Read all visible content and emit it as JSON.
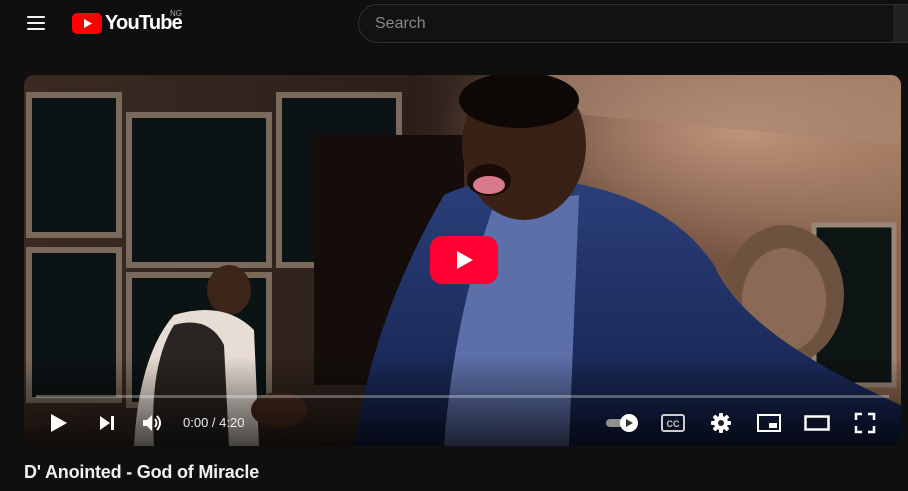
{
  "masthead": {
    "logo_text": "YouTube",
    "country_code": "NG",
    "search_placeholder": "Search"
  },
  "player": {
    "current_time": "0:00",
    "separator": " / ",
    "duration": "4:20",
    "progress": 0,
    "autoplay": true,
    "cc_label": "CC"
  },
  "video": {
    "title": "D' Anointed - God of Miracle"
  },
  "colors": {
    "brand_red": "#ff0000",
    "background": "#0f0f0f",
    "text": "#f1f1f1"
  },
  "icons": [
    "menu-icon",
    "youtube-logo-icon",
    "play-icon",
    "next-icon",
    "volume-icon",
    "autoplay-toggle-icon",
    "subtitles-icon",
    "settings-icon",
    "miniplayer-icon",
    "theater-icon",
    "fullscreen-icon"
  ]
}
